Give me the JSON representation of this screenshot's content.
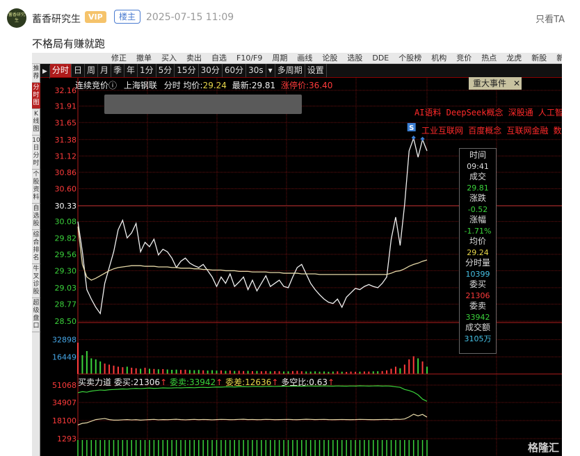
{
  "post": {
    "username": "蓄香研究生",
    "avatar_text": "蓄香研究生",
    "vip": "VIP",
    "host_tag": "楼主",
    "timestamp": "2025-07-15 11:09",
    "only_see": "只看TA",
    "text": "不格局有赚就跑"
  },
  "app": {
    "toolbar": [
      "修正",
      "撤单",
      "买入",
      "卖出",
      "自选",
      "F10/F9",
      "周期",
      "画线",
      "论股",
      "选股",
      "DDE",
      "个股榜",
      "机构",
      "竞价",
      "热点",
      "龙虎",
      "新股",
      "新闻"
    ],
    "left_rail": [
      "推荐",
      "分时图",
      "K线图",
      "10日分时",
      "个股资料",
      "自选股",
      "综合排名",
      "牛叉诊股",
      "超级盘口"
    ],
    "timeframes": [
      "分时",
      "日",
      "周",
      "月",
      "季",
      "年",
      "1分",
      "5分",
      "15分",
      "30分",
      "60分",
      "30s",
      "▾",
      "多周期",
      "设置"
    ],
    "info": {
      "mode": "连续竞价ⓘ",
      "stock": "上海钢联",
      "chart_label": "分时",
      "avg_label": "均价:",
      "avg_value": "29.24",
      "last_label": "最新:",
      "last_value": "29.81",
      "limit_label": "涨停价:",
      "limit_value": "36.40"
    },
    "event_button": "重大事件",
    "event_close": "✕",
    "concepts_line1": "AI语料 DeepSeek概念 深股通 人工智",
    "concepts_line2": "工业互联网 百度概念 互联网金融 数",
    "flow_title": "买卖力道",
    "flow_buy_label": "委买:",
    "flow_buy_value": "21306",
    "flow_sell_label": "委卖:",
    "flow_sell_value": "33942",
    "flow_diff_label": "委差:",
    "flow_diff_value": "12636",
    "flow_ratio_label": "多空比:",
    "flow_ratio_value": "0.63",
    "watermark": "格隆汇",
    "marker_s": "S"
  },
  "tooltip": {
    "time_label": "时间",
    "time_value": "09:41",
    "price_label": "成交",
    "price_value": "29.81",
    "chg_label": "涨跌",
    "chg_value": "-0.52",
    "pct_label": "涨幅",
    "pct_value": "-1.71%",
    "avg_label": "均价",
    "avg_value": "29.24",
    "vol_label": "分时量",
    "vol_value": "10399",
    "buy_label": "委买",
    "buy_value": "21306",
    "sell_label": "委卖",
    "sell_value": "33942",
    "amt_label": "成交额",
    "amt_value": "3105万"
  },
  "chart_data": {
    "type": "line",
    "price_ticks": [
      "32.16",
      "31.91",
      "31.65",
      "31.38",
      "31.12",
      "30.86",
      "30.60",
      "30.33",
      "30.08",
      "29.82",
      "29.56",
      "29.30",
      "29.03",
      "28.77",
      "28.50"
    ],
    "price_tick_colors": [
      "#ff3b3b",
      "#ff3b3b",
      "#ff3b3b",
      "#ff3b3b",
      "#ff3b3b",
      "#ff3b3b",
      "#ff3b3b",
      "#ffffff",
      "#3bd33b",
      "#3bd33b",
      "#3bd33b",
      "#3bd33b",
      "#3bd33b",
      "#3bd33b",
      "#3bd33b"
    ],
    "ylim": [
      28.5,
      32.16
    ],
    "prev_close": 30.33,
    "price": [
      30.08,
      29.6,
      29.0,
      28.85,
      28.72,
      28.62,
      29.1,
      29.35,
      29.6,
      29.95,
      30.1,
      29.82,
      29.9,
      30.05,
      29.6,
      29.75,
      29.68,
      29.8,
      29.55,
      29.64,
      29.6,
      29.5,
      29.35,
      29.45,
      29.5,
      29.42,
      29.38,
      29.35,
      29.4,
      29.3,
      29.2,
      29.05,
      29.2,
      29.1,
      29.25,
      29.05,
      29.12,
      29.2,
      29.0,
      29.15,
      28.98,
      29.1,
      29.22,
      29.05,
      29.1,
      29.15,
      29.05,
      29.03,
      29.2,
      29.35,
      29.4,
      29.25,
      29.1,
      29.0,
      28.92,
      28.85,
      28.8,
      28.78,
      28.85,
      28.72,
      28.88,
      28.95,
      29.02,
      29.0,
      29.05,
      29.08,
      29.05,
      29.03,
      29.1,
      29.2,
      29.8,
      30.15,
      29.7,
      30.35,
      31.2,
      31.4,
      31.1,
      31.38,
      31.2
    ],
    "avg": [
      30.0,
      29.4,
      29.2,
      29.15,
      29.18,
      29.22,
      29.26,
      29.3,
      29.33,
      29.35,
      29.36,
      29.37,
      29.38,
      29.38,
      29.38,
      29.37,
      29.37,
      29.37,
      29.36,
      29.36,
      29.36,
      29.35,
      29.35,
      29.34,
      29.34,
      29.34,
      29.33,
      29.33,
      29.32,
      29.32,
      29.31,
      29.31,
      29.31,
      29.3,
      29.3,
      29.3,
      29.29,
      29.29,
      29.29,
      29.28,
      29.28,
      29.28,
      29.28,
      29.27,
      29.27,
      29.27,
      29.26,
      29.26,
      29.26,
      29.26,
      29.25,
      29.25,
      29.25,
      29.25,
      29.24,
      29.24,
      29.24,
      29.24,
      29.24,
      29.24,
      29.24,
      29.24,
      29.24,
      29.24,
      29.24,
      29.24,
      29.24,
      29.24,
      29.24,
      29.24,
      29.26,
      29.29,
      29.3,
      29.33,
      29.37,
      29.4,
      29.42,
      29.45,
      29.47
    ],
    "volume_ticks": [
      "32898",
      "16449"
    ],
    "volume_max": 49347,
    "volume": [
      30000,
      18000,
      22000,
      15000,
      14000,
      12000,
      10000,
      9000,
      8000,
      7000,
      6500,
      7000,
      6000,
      5500,
      5000,
      6000,
      5000,
      4800,
      4500,
      4700,
      4300,
      4000,
      4200,
      3900,
      4100,
      3800,
      3600,
      3900,
      3500,
      3300,
      3600,
      3200,
      3400,
      3000,
      3300,
      2900,
      3100,
      2800,
      3000,
      2700,
      2900,
      2600,
      2800,
      2500,
      2700,
      2600,
      2400,
      2500,
      2800,
      3000,
      2600,
      2400,
      2300,
      2500,
      2200,
      2400,
      2100,
      2300,
      2500,
      2200,
      2000,
      2300,
      2100,
      2200,
      2400,
      2300,
      2500,
      2600,
      2800,
      3500,
      5000,
      7000,
      5500,
      9000,
      14000,
      17000,
      15000,
      12000,
      7000
    ],
    "flow_ticks": [
      "51068",
      "34907",
      "18100",
      "1293"
    ],
    "flow_ylim": [
      1293,
      51068
    ],
    "flow_buy": [
      14000,
      15500,
      16000,
      17500,
      19000,
      19500,
      20000,
      19000,
      18500,
      18500,
      18800,
      19000,
      18700,
      18900,
      18500,
      18800,
      19000,
      19200,
      18800,
      19000,
      18900,
      19100,
      19300,
      19000,
      18800,
      19000,
      19200,
      18900,
      19100,
      19000,
      18800,
      19000,
      19200,
      19100,
      18900,
      19000,
      19200,
      19300,
      19000,
      19100,
      18900,
      19000,
      19200,
      19100,
      18900,
      19000,
      19100,
      19200,
      19000,
      18900,
      19100,
      19300,
      19200,
      19000,
      19100,
      19200,
      19000,
      18900,
      19000,
      19100,
      19000,
      18900,
      19000,
      19200,
      19100,
      19000,
      18900,
      19000,
      19100,
      19200,
      19000,
      19300,
      19200,
      19600,
      21500,
      24000,
      22500,
      23800,
      21300
    ],
    "flow_sell": [
      44000,
      45000,
      44500,
      45500,
      46000,
      46500,
      46200,
      46800,
      47000,
      47200,
      47500,
      47300,
      47800,
      48000,
      47800,
      48100,
      48300,
      48000,
      48200,
      48500,
      48300,
      48400,
      48600,
      48500,
      48700,
      48800,
      48600,
      48900,
      49000,
      48800,
      49100,
      49300,
      49200,
      49400,
      49500,
      49300,
      49600,
      49700,
      49500,
      49800,
      49900,
      49700,
      49900,
      50000,
      49800,
      50000,
      50100,
      50000,
      50200,
      50100,
      50000,
      50200,
      50300,
      50100,
      50200,
      50300,
      50200,
      50100,
      50300,
      50200,
      50100,
      50300,
      50200,
      50400,
      50300,
      50200,
      50300,
      50400,
      50200,
      50300,
      50100,
      49500,
      49000,
      47000,
      46000,
      44500,
      42000,
      38000,
      36000
    ]
  }
}
